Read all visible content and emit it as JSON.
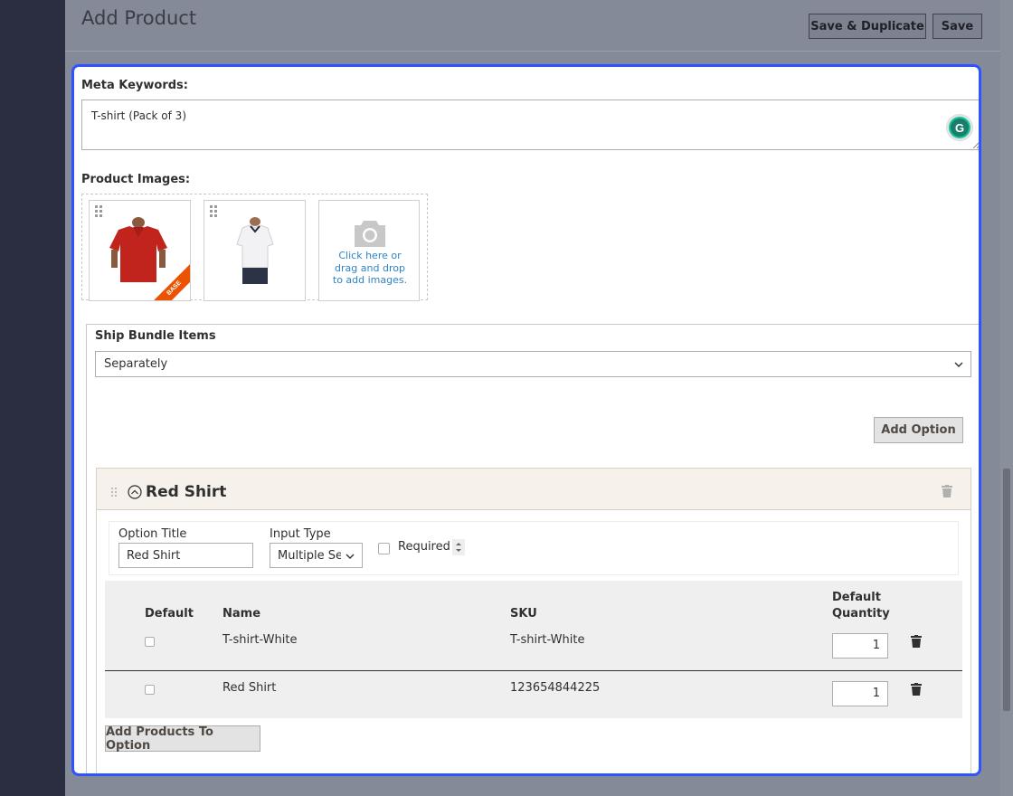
{
  "page": {
    "title": "Add Product"
  },
  "header": {
    "save_duplicate": "Save & Duplicate",
    "save": "Save"
  },
  "meta_keywords": {
    "label": "Meta Keywords:",
    "value": "T-shirt (Pack of 3)"
  },
  "product_images": {
    "label": "Product Images:",
    "base_badge": "BASE",
    "uploader_text": "Click here or drag and drop to add images."
  },
  "bundle": {
    "ship_label": "Ship Bundle Items",
    "ship_value": "Separately",
    "add_option": "Add Option",
    "option": {
      "title": "Red Shirt",
      "option_title_label": "Option Title",
      "option_title_value": "Red Shirt",
      "input_type_label": "Input Type",
      "input_type_value": "Multiple Select",
      "required_label": "Required",
      "columns": {
        "default": "Default",
        "name": "Name",
        "sku": "SKU",
        "qty_line1": "Default",
        "qty_line2": "Quantity"
      },
      "rows": [
        {
          "name": "T-shirt-White",
          "sku": "T-shirt-White",
          "qty": "1"
        },
        {
          "name": "Red Shirt",
          "sku": "123654844225",
          "qty": "1"
        }
      ],
      "add_products": "Add Products To Option"
    }
  },
  "colors": {
    "accent_border": "#2f54ff",
    "badge": "#eb5202",
    "link": "#2e84c5"
  },
  "icons": [
    "grammarly-icon",
    "drag-handle-icon",
    "camera-icon",
    "chevron-down-icon",
    "collapse-icon",
    "trash-icon"
  ]
}
